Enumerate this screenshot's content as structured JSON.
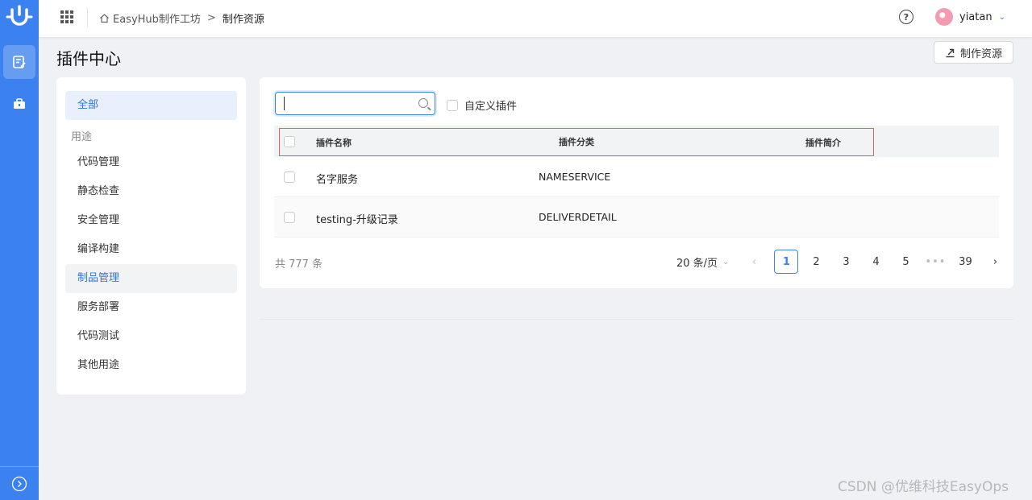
{
  "topbar": {
    "breadcrumb": {
      "home": "EasyHub制作工坊",
      "separator": ">",
      "current": "制作资源"
    },
    "user_name": "yiatan"
  },
  "page": {
    "title": "插件中心",
    "make_button_label": "制作资源"
  },
  "categories": {
    "all_label": "全部",
    "group_label": "用途",
    "items": [
      "代码管理",
      "静态检查",
      "安全管理",
      "编译构建",
      "制品管理",
      "服务部署",
      "代码测试",
      "其他用途"
    ]
  },
  "filter": {
    "search_value": "",
    "custom_plugin_label": "自定义插件"
  },
  "table": {
    "columns": [
      "插件名称",
      "插件分类",
      "插件简介"
    ],
    "rows": [
      {
        "name": "名字服务",
        "category": "NAMESERVICE",
        "description": ""
      },
      {
        "name": "testing-升级记录",
        "category": "DELIVERDETAIL",
        "description": ""
      }
    ]
  },
  "pagination": {
    "total_text": "共 777 条",
    "page_size": "20 条/页",
    "pages": [
      "1",
      "2",
      "3",
      "4",
      "5"
    ],
    "current_page": "1",
    "ellipsis": "•••",
    "last_page": "39"
  },
  "watermark": "CSDN @优维科技EasyOps",
  "colors": {
    "accent": "#3b82f0",
    "highlight_border": "#e2636a"
  }
}
